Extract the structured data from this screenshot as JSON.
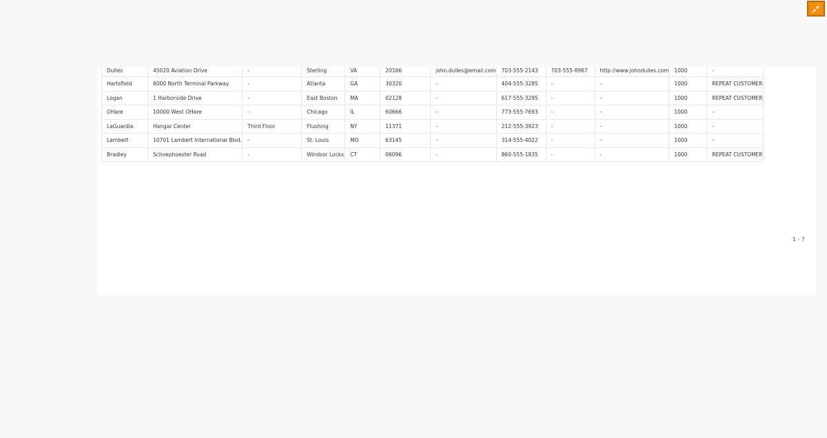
{
  "toolbar": {
    "restore_icon": "collapse-arrows-icon",
    "accent_color": "#f0900c"
  },
  "table": {
    "rows": [
      {
        "name": "Dulles",
        "address1": "45020 Aviation Drive",
        "address2": "-",
        "city": "Sterling",
        "state": "VA",
        "zip": "20166",
        "email": "john.dulles@email.com",
        "phone": "703-555-2143",
        "fax": "703-555-8967",
        "web": "http://www.johndulles.com",
        "credit": "1000",
        "note": "-"
      },
      {
        "name": "Hartsfield",
        "address1": "6000 North Terminal Parkway",
        "address2": "-",
        "city": "Atlanta",
        "state": "GA",
        "zip": "30320",
        "email": "-",
        "phone": "404-555-3285",
        "fax": "-",
        "web": "-",
        "credit": "1000",
        "note": "REPEAT CUSTOMER"
      },
      {
        "name": "Logan",
        "address1": "1 Harborside Drive",
        "address2": "-",
        "city": "East Boston",
        "state": "MA",
        "zip": "02128",
        "email": "-",
        "phone": "617-555-3295",
        "fax": "-",
        "web": "-",
        "credit": "1000",
        "note": "REPEAT CUSTOMER"
      },
      {
        "name": "OHare",
        "address1": "10000 West OHare",
        "address2": "-",
        "city": "Chicago",
        "state": "IL",
        "zip": "60666",
        "email": "-",
        "phone": "773-555-7693",
        "fax": "-",
        "web": "-",
        "credit": "1000",
        "note": "-"
      },
      {
        "name": "LaGuardia",
        "address1": "Hangar Center",
        "address2": "Third Floor",
        "city": "Flushing",
        "state": "NY",
        "zip": "11371",
        "email": "-",
        "phone": "212-555-3923",
        "fax": "-",
        "web": "-",
        "credit": "1000",
        "note": "-"
      },
      {
        "name": "Lambert",
        "address1": "10701 Lambert International Blvd.",
        "address2": "-",
        "city": "St. Louis",
        "state": "MO",
        "zip": "63145",
        "email": "-",
        "phone": "314-555-4022",
        "fax": "-",
        "web": "-",
        "credit": "1000",
        "note": "-"
      },
      {
        "name": "Bradley",
        "address1": "Schoephoester Road",
        "address2": "-",
        "city": "Windsor Locks",
        "state": "CT",
        "zip": "06096",
        "email": "-",
        "phone": "860-555-1835",
        "fax": "-",
        "web": "-",
        "credit": "1000",
        "note": "REPEAT CUSTOMER"
      }
    ]
  },
  "pager": {
    "range": "1 - 7"
  }
}
